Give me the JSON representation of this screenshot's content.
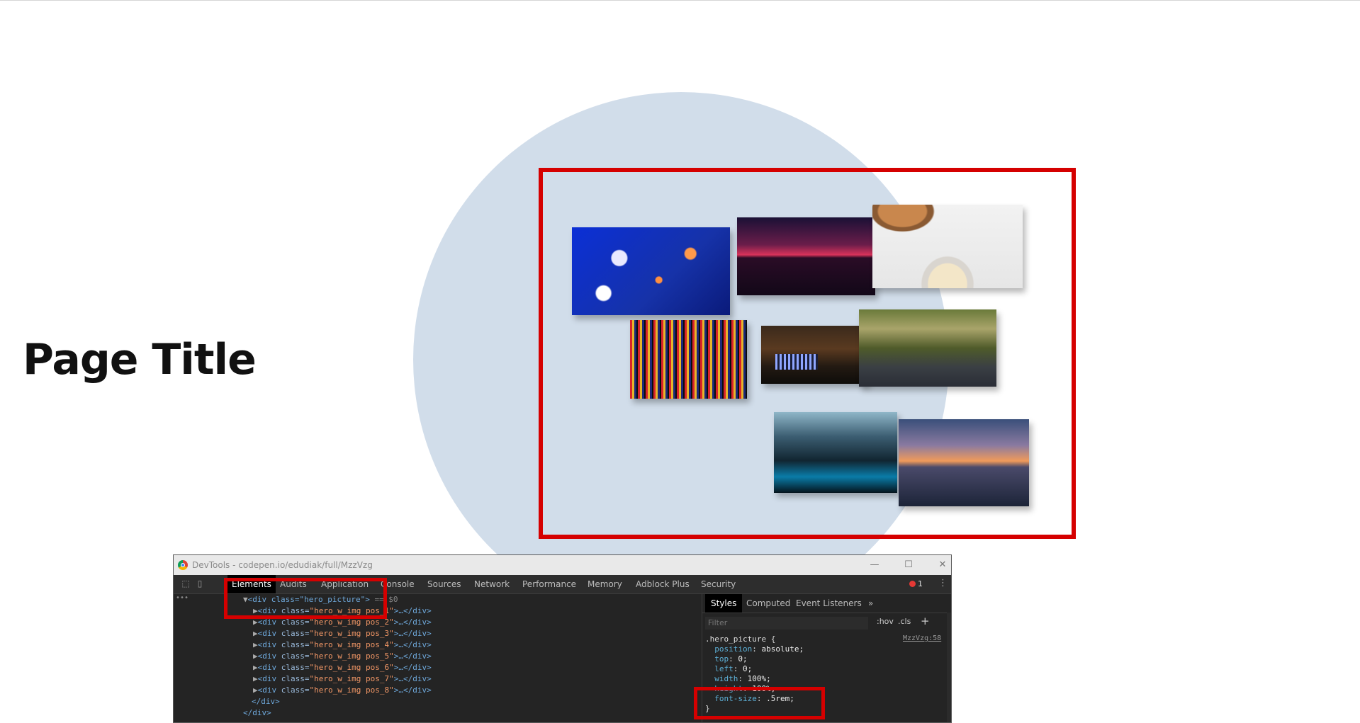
{
  "page": {
    "title": "Page Title"
  },
  "hero": {
    "photos": [
      "goldfish-pattern",
      "sunset-mountains",
      "coconut-rice-bowl",
      "pixel-stripes",
      "laptop-keyboard",
      "forest-river",
      "rocky-shore",
      "sunset-lake"
    ]
  },
  "colors": {
    "circle": "#d1ddea",
    "highlight": "#d50000",
    "devtools_bg": "#242424"
  },
  "devtools": {
    "window_title": "DevTools - codepen.io/edudiak/full/MzzVzg",
    "window_buttons": {
      "minimize": "—",
      "maximize": "☐",
      "close": "✕"
    },
    "tabs": [
      "Elements",
      "Audits",
      "Application",
      "Console",
      "Sources",
      "Network",
      "Performance",
      "Memory",
      "Adblock Plus",
      "Security"
    ],
    "active_tab": "Elements",
    "error_count": "1",
    "dom": {
      "root": "<div class=\"hero_picture\">",
      "root_suffix": "== $0",
      "children": [
        "hero_w_img pos_1",
        "hero_w_img pos_2",
        "hero_w_img pos_3",
        "hero_w_img pos_4",
        "hero_w_img pos_5",
        "hero_w_img pos_6",
        "hero_w_img pos_7",
        "hero_w_img pos_8"
      ],
      "close_div": "</div>",
      "close_div_outer": "</div>"
    },
    "styles": {
      "tabs": [
        "Styles",
        "Computed",
        "Event Listeners",
        "»"
      ],
      "active_tab": "Styles",
      "filter_placeholder": "Filter",
      "hov": ":hov",
      "cls": ".cls",
      "plus": "+",
      "source_link": "MzzVzg:58",
      "selector": ".hero_picture {",
      "declarations": [
        {
          "prop": "position",
          "value": "absolute;"
        },
        {
          "prop": "top",
          "value": "0;"
        },
        {
          "prop": "left",
          "value": "0;"
        },
        {
          "prop": "width",
          "value": "100%;"
        },
        {
          "prop": "height",
          "value": "100%;"
        },
        {
          "prop": "font-size",
          "value": ".5rem;"
        }
      ],
      "close_brace": "}"
    }
  }
}
